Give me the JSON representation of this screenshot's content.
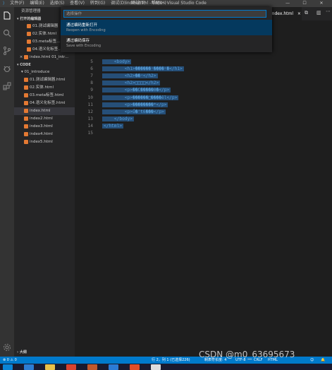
{
  "titlebar": {
    "menu": [
      "文件(F)",
      "编辑(E)",
      "选择(S)",
      "查看(V)",
      "转到(G)",
      "调试(D)",
      "终端(T)",
      "帮助(H)"
    ],
    "title": "index.html - code - Visual Studio Code",
    "min": "—",
    "max": "☐",
    "close": "✕"
  },
  "sidebar": {
    "header": "资源管理器",
    "open_editors_title": "打开的编辑器",
    "open_editors": [
      "01.测试编辑器",
      "02.实体.html",
      "03.meta标签...",
      "04.语义化标签...",
      "index.html  01_intr..."
    ],
    "workspace_title": "CODE",
    "folder": "01_introduce",
    "files": [
      "01.测试编辑器.html",
      "02.实体.html",
      "03.meta标签.html",
      "04.语义化标签.html",
      "index.html",
      "index2.html",
      "index3.html",
      "index4.html",
      "index5.html"
    ],
    "outline_title": "大纲"
  },
  "tab": {
    "label": "index.html",
    "close": "×"
  },
  "palette": {
    "placeholder": "选择操作",
    "items": [
      {
        "title": "通过编码重新打开",
        "subtitle": "Reopen with Encoding"
      },
      {
        "title": "通过编码保存",
        "subtitle": "Save with Encoding"
      }
    ]
  },
  "editor": {
    "lines": [
      {
        "n": "5",
        "code": "    <body>"
      },
      {
        "n": "6",
        "code": "        <h1>������ʵ����ʵ�</h1>"
      },
      {
        "n": "7",
        "code": "        <h2>��ʵ</h2>"
      },
      {
        "n": "8",
        "code": "        <h2>□□□□</h2>"
      },
      {
        "n": "9",
        "code": "        <p>��C�����ϴ�</p>"
      },
      {
        "n": "10",
        "code": "        <p>������□����ĕl</p>"
      },
      {
        "n": "11",
        "code": "        <p>��������*</p>"
      },
      {
        "n": "12",
        "code": "        <p>ǘ�'ŧ6���</p>"
      },
      {
        "n": "13",
        "code": "    </body>"
      },
      {
        "n": "14",
        "code": "</html>"
      },
      {
        "n": "15",
        "code": ""
      }
    ]
  },
  "statusbar": {
    "left": "⊗ 0 ⚠ 0",
    "position": "行 2，列 1 (已选择226)",
    "spaces": "制表符长度: 4",
    "encoding": "UTF-8",
    "eol": "CRLF",
    "lang": "HTML"
  },
  "watermark": "CSDN @m0_63695673"
}
